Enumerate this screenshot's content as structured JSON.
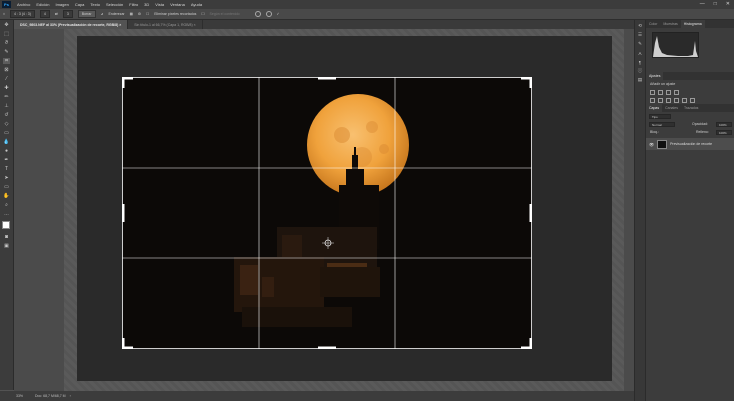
{
  "menubar": {
    "app_icon": "Ps",
    "items": [
      "Archivo",
      "Edición",
      "Imagen",
      "Capa",
      "Texto",
      "Selección",
      "Filtro",
      "3D",
      "Vista",
      "Ventana",
      "Ayuda"
    ],
    "window_controls": [
      "—",
      "□",
      "✕"
    ]
  },
  "options": {
    "ratio_value": "4 : 3 (4 : 3)",
    "ratio_w": "4",
    "ratio_h": "3",
    "clear_label": "Borrar",
    "straighten_label": "Enderezar",
    "delete_cropped_label": "Eliminar píxeles recortados",
    "content_aware_label": "Según el contenido"
  },
  "tabs": [
    {
      "label": "DSC_9803.NEF al 33% (Previsualización de recorte, RGB/8) ×",
      "active": true
    },
    {
      "label": "Sin título-1 al 66,7% (Capa 1, RGB/8) ×",
      "active": false
    }
  ],
  "status": {
    "zoom": "33%",
    "doc_info": "Doc: 68,7 M/68,7 M"
  },
  "panels": {
    "top_tabs": [
      "Color",
      "Muestras",
      "Histograma"
    ],
    "adjustments_tabs": [
      "Ajustes"
    ],
    "adjustments_subtitle": "Añadir un ajuste",
    "layers_tabs": [
      "Capas",
      "Canales",
      "Trazados"
    ],
    "blend_mode": "Normal",
    "opacity_label": "Opacidad:",
    "opacity_value": "100%",
    "lock_label": "Bloq.:",
    "fill_label": "Relleno:",
    "fill_value": "100%",
    "layer_name": "Previsualización de recorte",
    "kind_label": "Tipo"
  },
  "colors": {
    "moon": "#f0a23c",
    "building_glow": "#8a4a1c",
    "crop_grid": "#ffffff"
  }
}
